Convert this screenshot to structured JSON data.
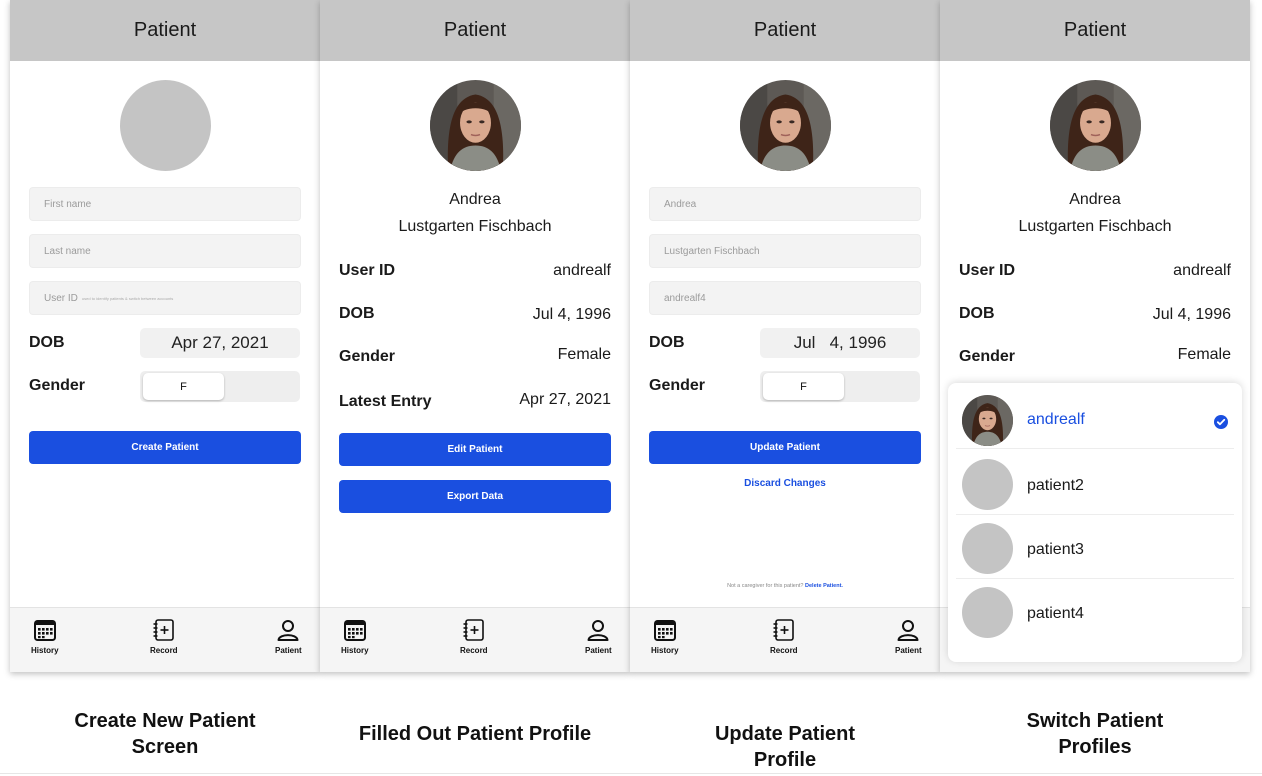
{
  "header_title": "Patient",
  "tabs": [
    "History",
    "Record",
    "Patient"
  ],
  "screens": {
    "create": {
      "first_name_placeholder": "First name",
      "last_name_placeholder": "Last name",
      "user_id_placeholder": "User ID",
      "user_id_hint": "used to identify patients & switch between accounts",
      "dob_label": "DOB",
      "dob_value": "Apr 27, 2021",
      "gender_label": "Gender",
      "gender_value": "F",
      "button": "Create Patient",
      "caption": "Create New Patient Screen"
    },
    "profile": {
      "first_name": "Andrea",
      "last_name": "Lustgarten Fischbach",
      "rows": [
        {
          "label": "User ID",
          "value": "andrealf"
        },
        {
          "label": "DOB",
          "value": "Jul 4, 1996"
        },
        {
          "label": "Gender",
          "value": "Female"
        },
        {
          "label": "Latest Entry",
          "value": "Apr 27, 2021"
        }
      ],
      "edit_button": "Edit Patient",
      "export_button": "Export Data",
      "caption": "Filled Out Patient Profile"
    },
    "update": {
      "first_name_value": "Andrea",
      "last_name_value": "Lustgarten Fischbach",
      "user_id_value": "andrealf4",
      "dob_label": "DOB",
      "dob_value": "Jul   4, 1996",
      "gender_label": "Gender",
      "gender_value": "F",
      "button": "Update Patient",
      "discard": "Discard Changes",
      "note": "Not a caregiver for this patient?",
      "delete": "Delete Patient.",
      "caption": "Update Patient Profile"
    },
    "switch": {
      "first_name": "Andrea",
      "last_name": "Lustgarten Fischbach",
      "rows": [
        {
          "label": "User ID",
          "value": "andrealf"
        },
        {
          "label": "DOB",
          "value": "Jul 4, 1996"
        },
        {
          "label": "Gender",
          "value": "Female"
        }
      ],
      "profiles": [
        "andrealf",
        "patient2",
        "patient3",
        "patient4"
      ],
      "selected_profile": "andrealf",
      "caption": "Switch Patient Profiles"
    }
  },
  "colors": {
    "accent": "#1a4fe0",
    "header": "#c6c6c6",
    "placeholder_avatar": "#c4c4c4"
  }
}
